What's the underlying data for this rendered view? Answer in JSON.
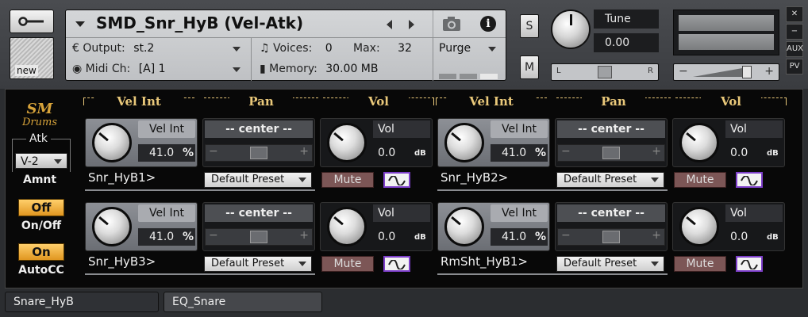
{
  "header": {
    "instrument_name": "SMD_Snr_HyB (Vel-Atk)",
    "output_label": "Output:",
    "output_value": "st.2",
    "midi_label": "Midi Ch:",
    "midi_value": "[A]  1",
    "voices_label": "Voices:",
    "voices_value": "0",
    "max_label": "Max:",
    "max_value": "32",
    "memory_label": "Memory:",
    "memory_value": "30.00 MB",
    "purge_label": "Purge",
    "solo_label": "S",
    "mute_label": "M",
    "tune_label": "Tune",
    "tune_value": "0.00",
    "pan_left": "L",
    "pan_right": "R",
    "new_label": "new",
    "minus": "−",
    "plus": "+",
    "side_buttons": [
      "✕",
      "−",
      "AUX",
      "PV"
    ]
  },
  "left_panel": {
    "logo_top": "SM",
    "logo_bottom": "Drums",
    "atk_label": "Atk",
    "atk_value": "V-2",
    "amnt_label": "Amnt",
    "off_button": "Off",
    "onoff_label": "On/Off",
    "on_button": "On",
    "autocc_label": "AutoCC"
  },
  "column_headers": {
    "vel_int": "Vel Int",
    "pan": "Pan",
    "vol": "Vol"
  },
  "channels": [
    {
      "name": "Snr_HyB1>",
      "vel_label": "Vel Int",
      "vel_value": "41.0",
      "vel_unit": "%",
      "pan_value": "-- center --",
      "vol_label": "Vol",
      "vol_value": "0.0",
      "vol_unit": "dB",
      "preset": "Default Preset",
      "mute": "Mute"
    },
    {
      "name": "Snr_HyB2>",
      "vel_label": "Vel Int",
      "vel_value": "41.0",
      "vel_unit": "%",
      "pan_value": "-- center --",
      "vol_label": "Vol",
      "vol_value": "0.0",
      "vol_unit": "dB",
      "preset": "Default Preset",
      "mute": "Mute"
    },
    {
      "name": "Snr_HyB3>",
      "vel_label": "Vel Int",
      "vel_value": "41.0",
      "vel_unit": "%",
      "pan_value": "-- center --",
      "vol_label": "Vol",
      "vol_value": "0.0",
      "vol_unit": "dB",
      "preset": "Default Preset",
      "mute": "Mute"
    },
    {
      "name": "RmSht_HyB1>",
      "vel_label": "Vel Int",
      "vel_value": "41.0",
      "vel_unit": "%",
      "pan_value": "-- center --",
      "vol_label": "Vol",
      "vol_value": "0.0",
      "vol_unit": "dB",
      "preset": "Default Preset",
      "mute": "Mute"
    }
  ],
  "tabs": [
    {
      "label": "Snare_HyB"
    },
    {
      "label": "EQ_Snare"
    }
  ],
  "colors": {
    "accent_gold": "#e9c87a",
    "orange_button": "#f0b040",
    "mute_red": "#7c5656",
    "wave_purple": "#7d3fc9"
  }
}
